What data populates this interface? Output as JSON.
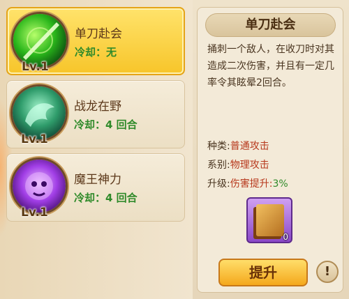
{
  "skills": [
    {
      "name": "单刀赴会",
      "cooldown": "冷却：无",
      "level": "Lv.1",
      "icon": "green-blade-icon",
      "selected": true
    },
    {
      "name": "战龙在野",
      "cooldown": "冷却：4 回合",
      "level": "Lv.1",
      "icon": "jade-dragon-icon",
      "selected": false
    },
    {
      "name": "魔王神力",
      "cooldown": "冷却：4 回合",
      "level": "Lv.1",
      "icon": "purple-demon-icon",
      "selected": false
    }
  ],
  "detail": {
    "title": "单刀赴会",
    "description": "捅刺一个敌人，在收刀时对其造成二次伤害，并且有一定几率令其眩晕2回合。",
    "type_label": "种类:",
    "type_value": "普通攻击",
    "system_label": "系别:",
    "system_value": "物理攻击",
    "upgrade_label": "升级:",
    "upgrade_value": "伤害提升:",
    "upgrade_percent": "3%",
    "book_count": "0",
    "upgrade_button": "提升",
    "info_button": "!"
  }
}
